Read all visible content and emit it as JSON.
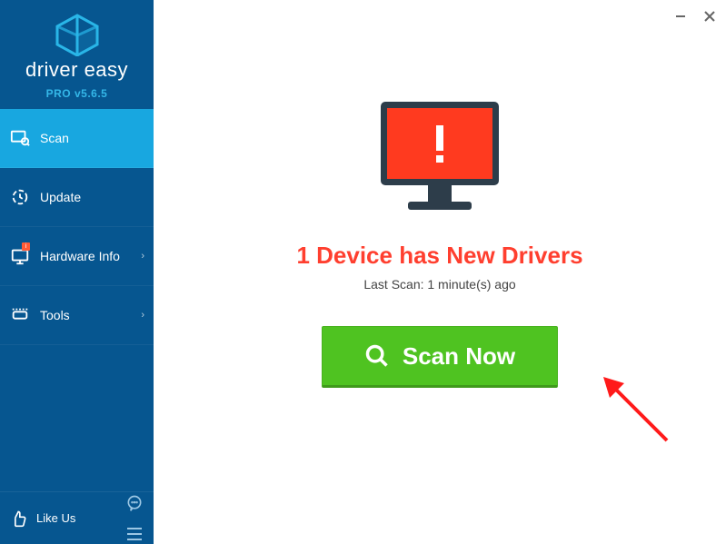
{
  "brand": {
    "name": "driver easy",
    "version": "PRO v5.6.5"
  },
  "sidebar": {
    "items": [
      {
        "label": "Scan"
      },
      {
        "label": "Update"
      },
      {
        "label": "Hardware Info"
      },
      {
        "label": "Tools"
      }
    ],
    "like": {
      "label": "Like Us"
    }
  },
  "main": {
    "headline": "1 Device has New Drivers",
    "last_scan": "Last Scan: 1 minute(s) ago",
    "scan_button": "Scan Now"
  },
  "colors": {
    "sidebar_bg": "#065690",
    "accent": "#18a7e0",
    "green": "#4fc321",
    "alert": "#ff3f2f"
  }
}
